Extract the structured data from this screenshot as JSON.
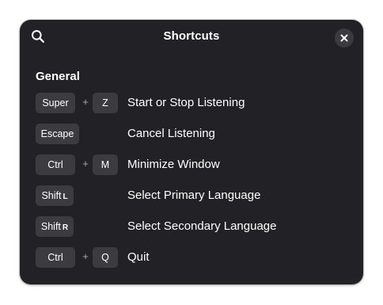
{
  "dialog": {
    "title": "Shortcuts",
    "search_icon": "search-icon",
    "close_icon": "close-icon"
  },
  "section": {
    "title": "General"
  },
  "shortcuts": [
    {
      "keys": [
        "Super",
        "Z"
      ],
      "separator": "+",
      "action": "Start or Stop Listening"
    },
    {
      "keys": [
        "Escape"
      ],
      "action": "Cancel Listening"
    },
    {
      "keys": [
        "Ctrl",
        "M"
      ],
      "separator": "+",
      "action": "Minimize Window"
    },
    {
      "keys": [
        {
          "main": "Shift",
          "sub": "L"
        }
      ],
      "action": "Select Primary Language"
    },
    {
      "keys": [
        {
          "main": "Shift",
          "sub": "R"
        }
      ],
      "action": "Select Secondary Language"
    },
    {
      "keys": [
        "Ctrl",
        "Q"
      ],
      "separator": "+",
      "action": "Quit"
    }
  ],
  "colors": {
    "background": "#222226",
    "key_background": "#3b3b40",
    "text": "#ffffff",
    "muted": "#a9a9ae"
  }
}
